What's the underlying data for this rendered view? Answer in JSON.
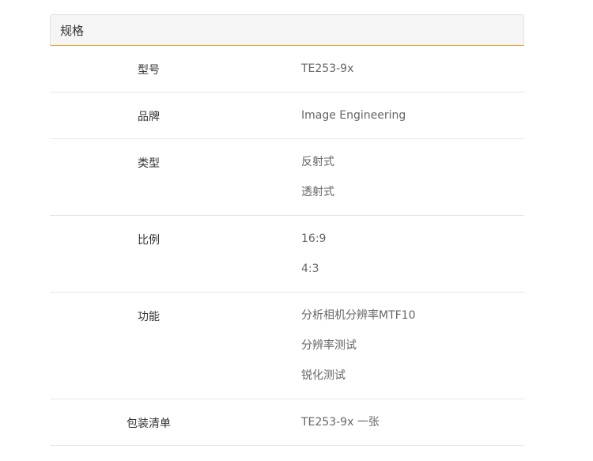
{
  "panel": {
    "title": "规格"
  },
  "specs": [
    {
      "label": "型号",
      "values": [
        "TE253-9x"
      ]
    },
    {
      "label": "品牌",
      "values": [
        "Image Engineering"
      ]
    },
    {
      "label": "类型",
      "values": [
        "反射式",
        "透射式"
      ]
    },
    {
      "label": "比例",
      "values": [
        "16:9",
        "4:3"
      ]
    },
    {
      "label": "功能",
      "values": [
        "分析相机分辨率MTF10",
        "分辨率测试",
        "锐化测试"
      ]
    },
    {
      "label": "包装清单",
      "values": [
        "TE253-9x 一张"
      ]
    }
  ],
  "colors": {
    "header_bg": "#f5f5f5",
    "header_accent": "#e8a33a",
    "divider": "#e6e6e6",
    "label_text": "#333333",
    "value_text": "#666666"
  }
}
